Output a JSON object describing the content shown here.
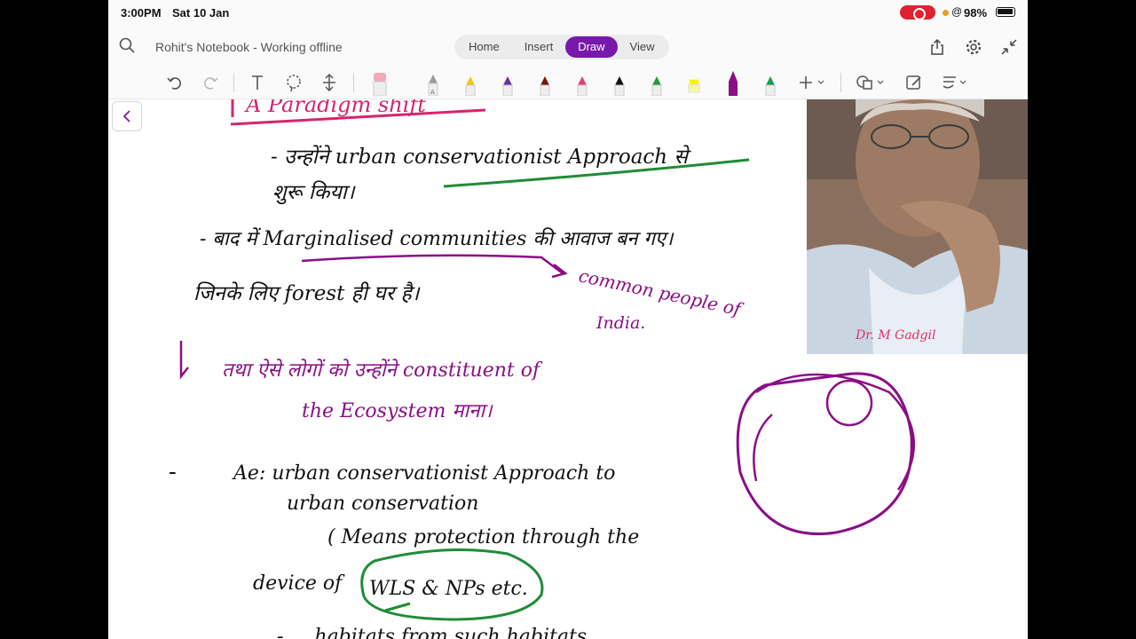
{
  "status": {
    "time": "3:00PM",
    "date": "Sat 10 Jan",
    "battery": "98%"
  },
  "title": {
    "notebook": "Rohit's Notebook - Working offline"
  },
  "tabs": [
    {
      "label": "Home",
      "active": false
    },
    {
      "label": "Insert",
      "active": false
    },
    {
      "label": "Draw",
      "active": true
    },
    {
      "label": "View",
      "active": false
    }
  ],
  "colors": {
    "accent": "#7719aa",
    "ink_black": "#111111",
    "ink_pink": "#d6246e",
    "ink_purple": "#8a0f86",
    "ink_green": "#1f8c36"
  },
  "pens": [
    "#f3a9b8",
    "#9a9a9a",
    "#f5c518",
    "#6a2fa8",
    "#7a1010",
    "#e53a7a",
    "#111111",
    "#1f9c3e",
    "#f5f500",
    "#8a0f86",
    "#1a9c4e"
  ],
  "notes": {
    "heading": "A Paradigm shift",
    "l1a": "- उन्होंने urban conservationist Approach से",
    "l1b": "शुरू किया।",
    "l2a": "- बाद में Marginalised communities की आवाज बन गए।",
    "l2b": "जिनके लिए forest ही घर है।",
    "side_note_1": "common people of",
    "side_note_2": "India.",
    "l3a": "तथा ऐसे लोगों को उन्होंने constituent of",
    "l3b": "the Ecosystem माना।",
    "l4_dash": "-",
    "l4a": "Ae: urban conservationist Approach to",
    "l4b": "urban conservation",
    "l5a": "( Means protection through the",
    "l5b_prefix": "device of",
    "l5b_circled": "WLS & NPs etc.",
    "l6": "- ... habitats from such habitats"
  },
  "photo": {
    "caption": "Dr. M Gadgil"
  }
}
